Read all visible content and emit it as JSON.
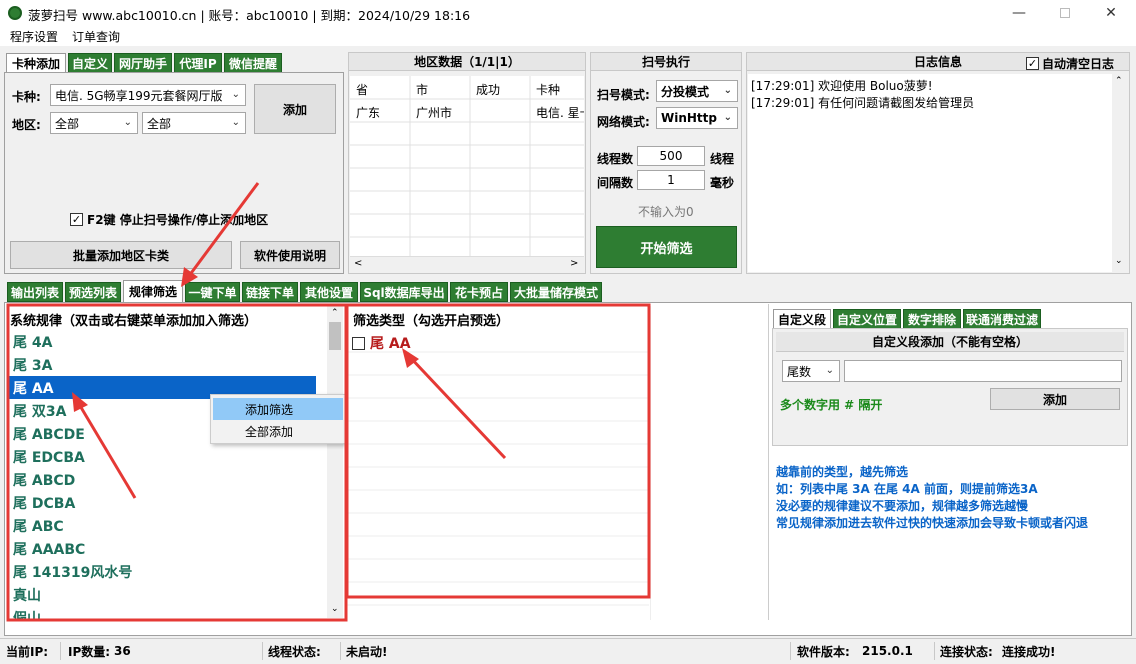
{
  "window": {
    "title": "菠萝扫号 www.abc10010.cn  |  账号：abc10010  |  到期：2024/10/29 18:16",
    "minimize_icon": "minimize-icon",
    "maximize_icon": "maximize-icon",
    "close_icon": "close-icon"
  },
  "menu": [
    "程序设置",
    "订单查询"
  ],
  "top_tabs": [
    "卡种添加",
    "自定义",
    "网厅助手",
    "代理IP",
    "微信提醒"
  ],
  "card_add": {
    "card_label": "卡种:",
    "card_value": "电信. 5G畅享199元套餐网厅版",
    "region_label": "地区:",
    "region_value1": "全部",
    "region_value2": "全部",
    "add_button": "添加",
    "f2_checkbox": "F2键 停止扫号操作/停止添加地区",
    "batch_button": "批量添加地区卡类",
    "manual_button": "软件使用说明"
  },
  "region_data": {
    "title": "地区数据（1/1|1）",
    "headers": [
      "省",
      "市",
      "成功",
      "卡种"
    ],
    "row": [
      "广东",
      "广州市",
      "",
      "电信. 星卡"
    ]
  },
  "scan": {
    "title": "扫号执行",
    "mode_label": "扫号模式:",
    "mode_value": "分投模式",
    "net_label": "网络模式:",
    "net_value": "WinHttp",
    "threads_label": "线程数",
    "threads_value": "500",
    "threads_unit": "线程",
    "interval_label": "间隔数",
    "interval_value": "1",
    "interval_unit": "毫秒",
    "hint": "不输入为0",
    "start_button": "开始筛选"
  },
  "log": {
    "title": "日志信息",
    "autoclear": "自动清空日志",
    "lines": [
      "[17:29:01] 欢迎使用 Boluo菠萝!",
      "[17:29:01] 有任何问题请截图发给管理员"
    ]
  },
  "main_tabs": [
    "输出列表",
    "预选列表",
    "规律筛选",
    "一键下单",
    "链接下单",
    "其他设置",
    "Sql数据库导出",
    "花卡预占",
    "大批量储存模式"
  ],
  "rules": {
    "header": "系统规律（双击或右键菜单添加加入筛选）",
    "items": [
      "尾 4A",
      "尾 3A",
      "尾 AA",
      "尾 双3A",
      "尾 ABCDE",
      "尾 EDCBA",
      "尾 ABCD",
      "尾 DCBA",
      "尾 ABC",
      "尾 AAABC",
      "尾 141319风水号",
      "真山",
      "假山"
    ],
    "selected_index": 2
  },
  "context_menu": [
    "添加筛选",
    "全部添加"
  ],
  "filter": {
    "header": "筛选类型（勾选开启预选）",
    "items": [
      "尾 AA"
    ]
  },
  "custom": {
    "tabs": [
      "自定义段",
      "自定义位置",
      "数字排除",
      "联通消费过滤"
    ],
    "group_title": "自定义段添加（不能有空格）",
    "type_value": "尾数",
    "hint": "多个数字用 # 隔开",
    "add_button": "添加",
    "info": [
      "越靠前的类型，越先筛选",
      "如：列表中尾 3A 在尾 4A 前面，则提前筛选3A",
      "没必要的规律建议不要添加，规律越多筛选越慢",
      "常见规律添加进去软件过快的快速添加会导致卡顿或者闪退"
    ]
  },
  "status": {
    "ip_label": "当前IP:",
    "ip_count_label": "IP数量:",
    "ip_count": "36",
    "thread_label": "线程状态:",
    "thread_value": "未启动!",
    "version_label": "软件版本:",
    "version": "215.0.1",
    "conn_label": "连接状态:",
    "conn_value": "连接成功!"
  },
  "colors": {
    "tab_green": "#2e7d32",
    "rule_text": "#1e6f5c",
    "selection": "#0a64c8",
    "annotation_red": "#e53935",
    "filter_text": "#b71c1c"
  }
}
